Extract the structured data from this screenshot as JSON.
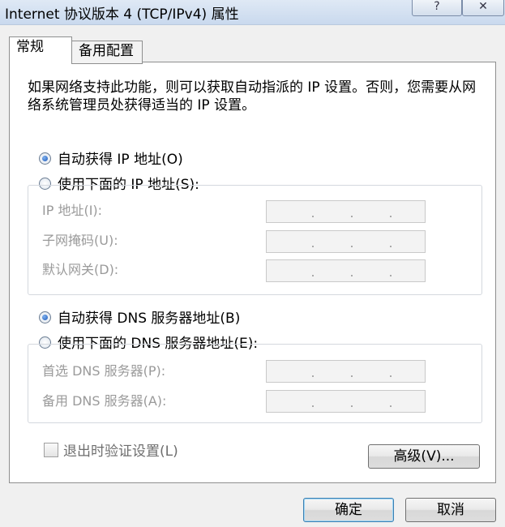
{
  "window": {
    "title": "Internet 协议版本 4 (TCP/IPv4) 属性",
    "help_label": "?",
    "close_label": "✕"
  },
  "tabs": [
    {
      "label": "常规",
      "selected": true
    },
    {
      "label": "备用配置",
      "selected": false
    }
  ],
  "description": "如果网络支持此功能，则可以获取自动指派的 IP 设置。否则，您需要从网络系统管理员处获得适当的 IP 设置。",
  "ip": {
    "auto_label": "自动获得 IP 地址(O)",
    "manual_label": "使用下面的 IP 地址(S):",
    "selected": "auto",
    "fields": [
      {
        "label": "IP 地址(I):",
        "value": ". . ."
      },
      {
        "label": "子网掩码(U):",
        "value": ". . ."
      },
      {
        "label": "默认网关(D):",
        "value": ". . ."
      }
    ]
  },
  "dns": {
    "auto_label": "自动获得 DNS 服务器地址(B)",
    "manual_label": "使用下面的 DNS 服务器地址(E):",
    "selected": "auto",
    "fields": [
      {
        "label": "首选 DNS 服务器(P):",
        "value": ". . ."
      },
      {
        "label": "备用 DNS 服务器(A):",
        "value": ". . ."
      }
    ]
  },
  "validate": {
    "label": "退出时验证设置(L)",
    "checked": false
  },
  "buttons": {
    "advanced": "高级(V)...",
    "ok": "确定",
    "cancel": "取消"
  }
}
